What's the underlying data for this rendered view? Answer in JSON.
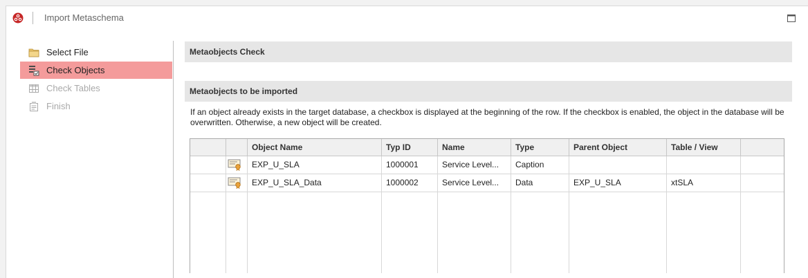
{
  "window": {
    "title": "Import Metaschema",
    "logo_icon": "app-logo-icon",
    "maximize_icon": "maximize-icon",
    "close_icon": "close-icon"
  },
  "sidebar": {
    "items": [
      {
        "label": "Select File",
        "icon": "folder-icon",
        "state": "done"
      },
      {
        "label": "Check Objects",
        "icon": "check-objects-icon",
        "state": "active"
      },
      {
        "label": "Check Tables",
        "icon": "table-icon",
        "state": "disabled"
      },
      {
        "label": "Finish",
        "icon": "finish-icon",
        "state": "disabled"
      }
    ],
    "active_color": "#f49b9b"
  },
  "main": {
    "section1_title": "Metaobjects Check",
    "section2_title": "Metaobjects to be imported",
    "info_text": "If an object already exists in the target database, a checkbox is displayed at the beginning of the row.  If the checkbox is enabled, the object in the database will be overwritten. Otherwise, a new object will be created."
  },
  "grid": {
    "columns": [
      "Object Name",
      "Typ ID",
      "Name",
      "Type",
      "Parent Object",
      "Table / View"
    ],
    "rows": [
      {
        "object_name": "EXP_U_SLA",
        "typ_id": "1000001",
        "name": "Service Level...",
        "type": "Caption",
        "parent_object": "",
        "table_view": ""
      },
      {
        "object_name": "EXP_U_SLA_Data",
        "typ_id": "1000002",
        "name": "Service Level...",
        "type": "Data",
        "parent_object": "EXP_U_SLA",
        "table_view": "xtSLA"
      }
    ]
  }
}
